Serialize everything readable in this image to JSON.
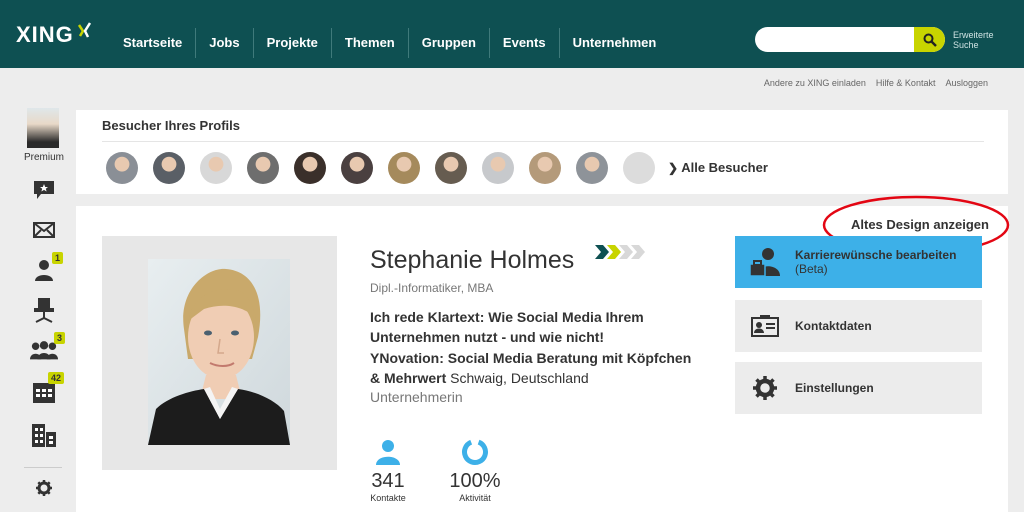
{
  "header": {
    "logo": "XING",
    "nav": [
      "Startseite",
      "Jobs",
      "Projekte",
      "Themen",
      "Gruppen",
      "Events",
      "Unternehmen"
    ],
    "search_placeholder": "",
    "advanced_search": "Erweiterte Suche"
  },
  "util_links": [
    "Andere zu XING einladen",
    "Hilfe & Kontakt",
    "Ausloggen"
  ],
  "sidebar": {
    "membership": "Premium",
    "badges": {
      "contacts": "1",
      "groups": "3",
      "events": "42"
    }
  },
  "visitors": {
    "title": "Besucher Ihres Profils",
    "all_link": "Alle Besucher",
    "avatar_tones": [
      "#8a8f96",
      "#5a5f66",
      "#d8d8d8",
      "#6e6e6e",
      "#3a2f2a",
      "#4a4040",
      "#a58a5c",
      "#665c50",
      "#c7c9cc",
      "#b49a7a",
      "#8e9399",
      "#d9d9d9"
    ]
  },
  "profile": {
    "old_design_link": "Altes Design anzeigen",
    "name": "Stephanie Holmes",
    "degree": "Dipl.-Informatiker, MBA",
    "headline": "Ich rede Klartext: Wie Social Media Ihrem Unternehmen nutzt - und wie nicht!",
    "company_name": "YNovation: Social Media Beratung mit Köpfchen & Mehrwert",
    "location": "Schwaig, Deutschland",
    "role": "Unternehmerin",
    "stats": {
      "contacts_value": "341",
      "contacts_label": "Kontakte",
      "activity_value": "100%",
      "activity_label": "Aktivität"
    },
    "actions": {
      "career": "Karrierewünsche bearbeiten",
      "career_sub": "(Beta)",
      "contact": "Kontaktdaten",
      "settings": "Einstellungen"
    }
  },
  "colors": {
    "topbar": "#0e5052",
    "accent": "#c8d400",
    "action_blue": "#3db0e8",
    "highlight_ellipse": "#e30613"
  }
}
